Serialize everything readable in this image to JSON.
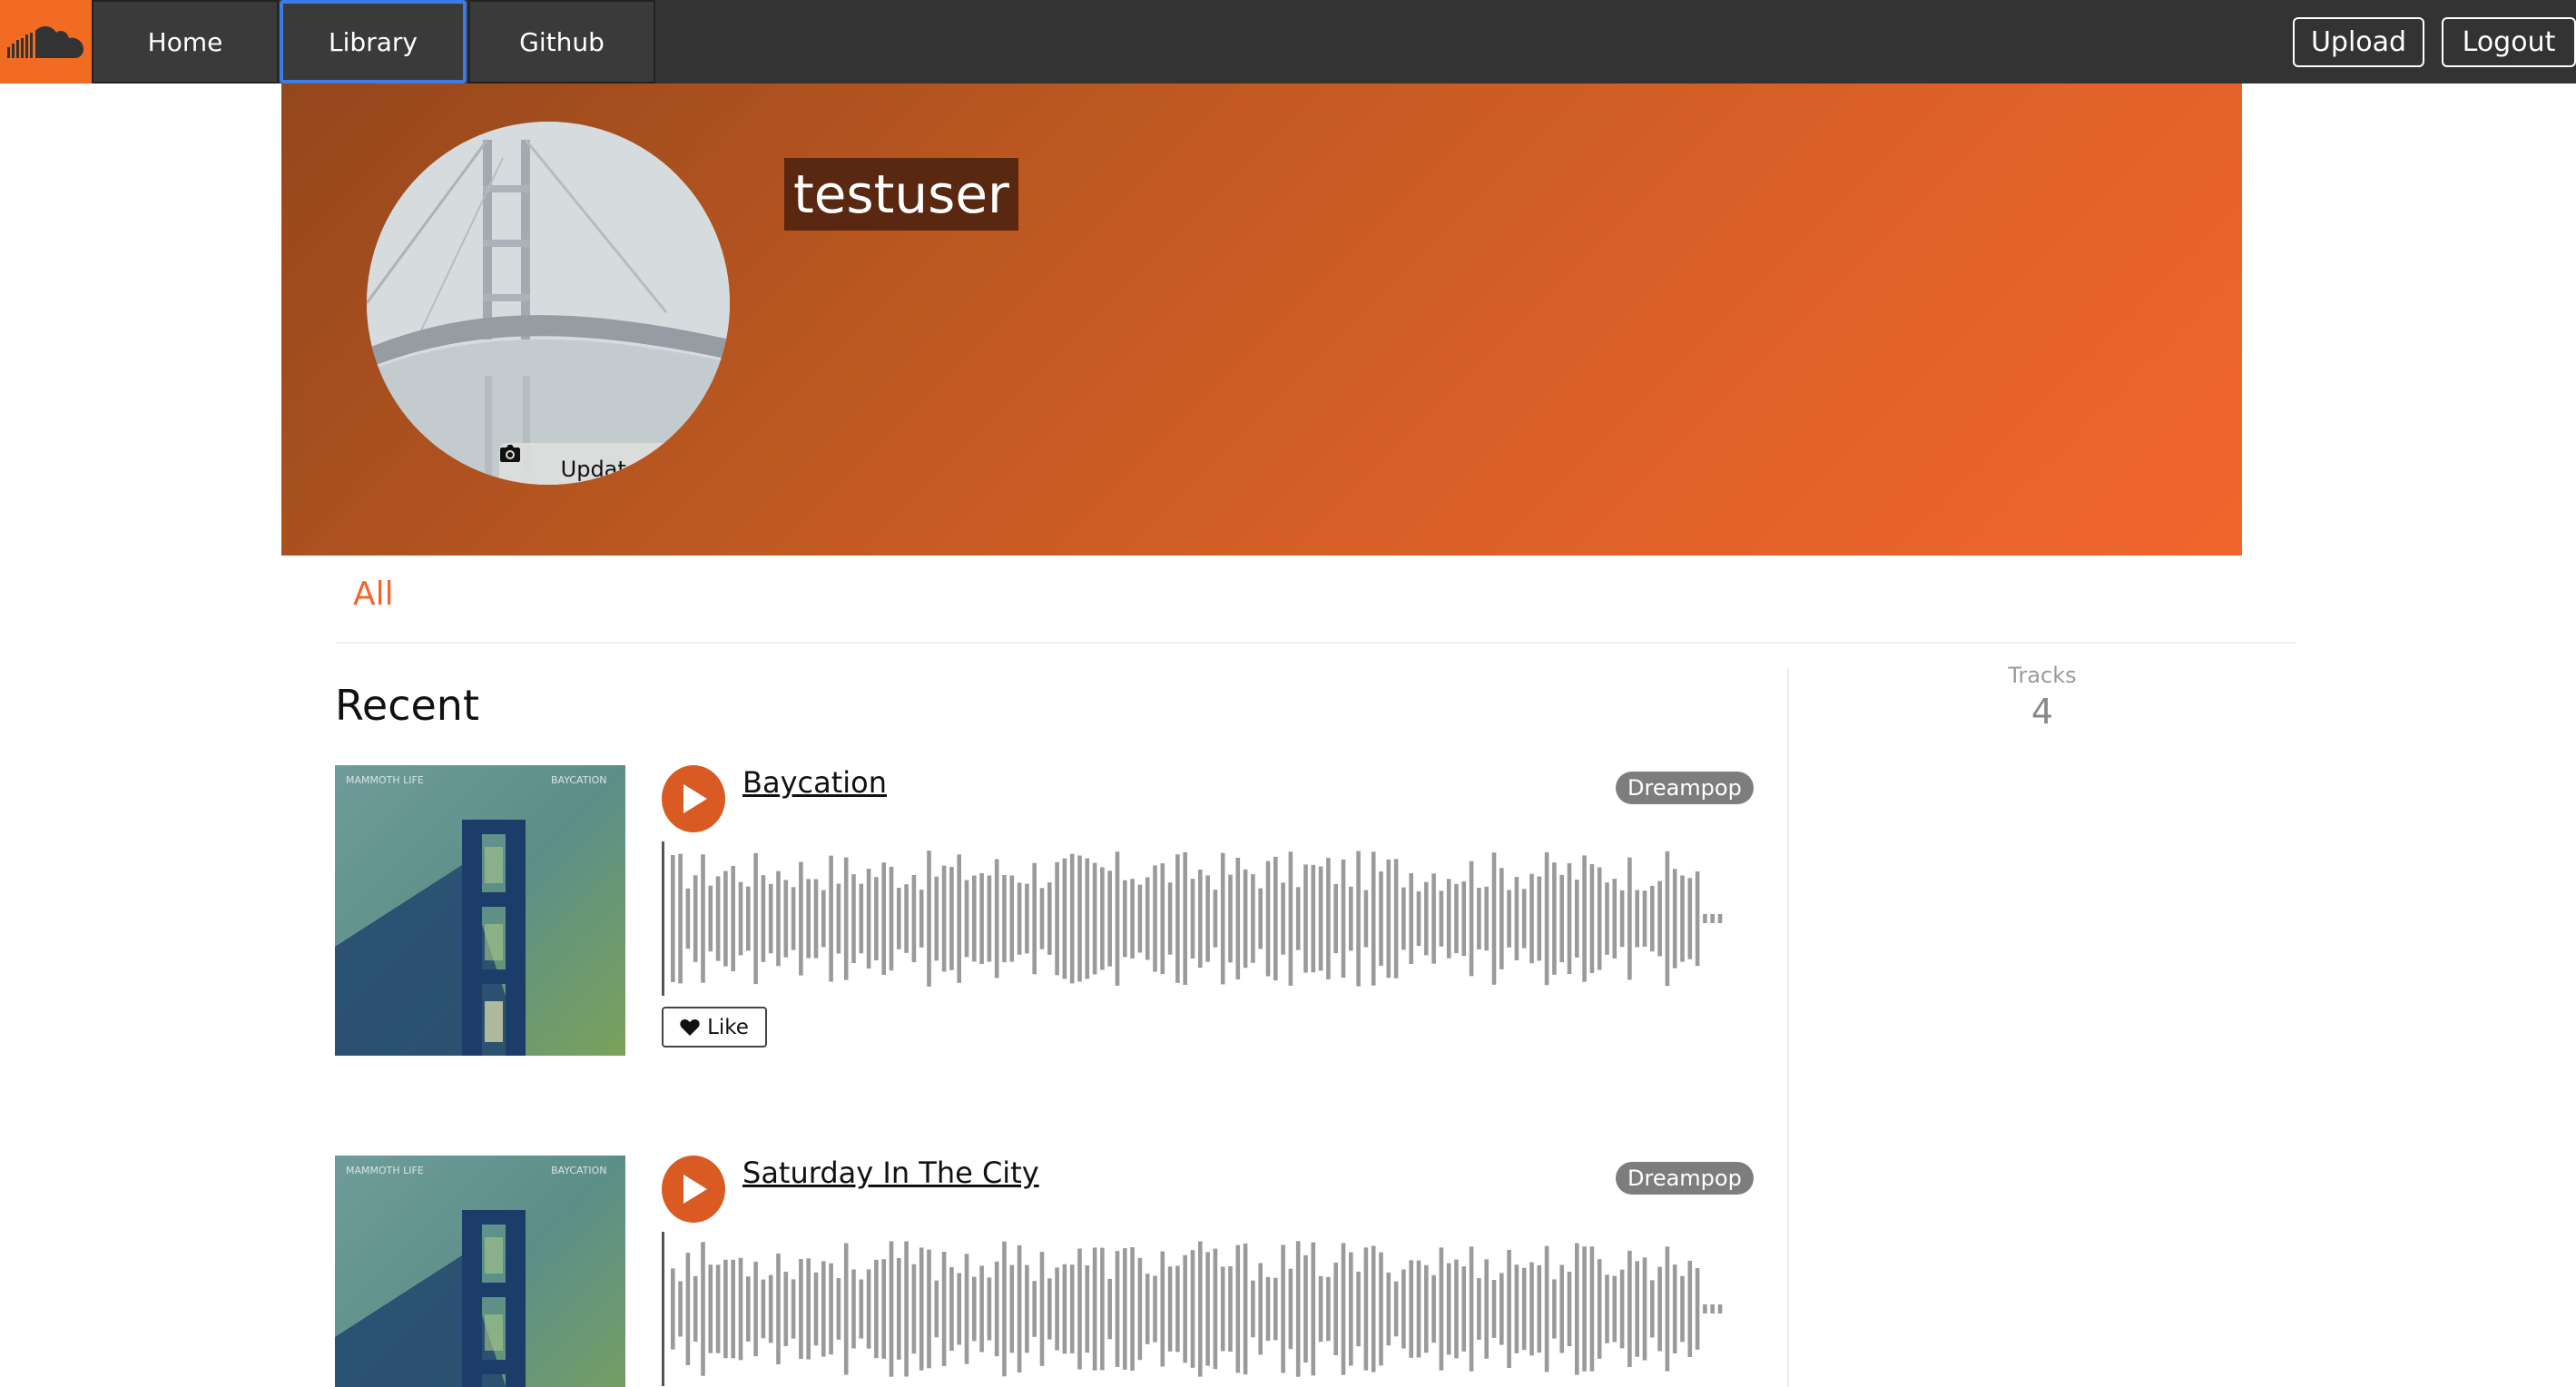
{
  "nav": {
    "logo_icon": "cloud-icon",
    "brand_color": "#f26b22",
    "tabs": [
      {
        "label": "Home"
      },
      {
        "label": "Library"
      },
      {
        "label": "Github"
      }
    ],
    "upload_label": "Upload",
    "logout_label": "Logout"
  },
  "profile": {
    "username": "testuser",
    "update_image_label": "Update Image",
    "update_image_icon": "camera-icon"
  },
  "tabs": {
    "all_label": "All"
  },
  "recent": {
    "title": "Recent",
    "tracks": [
      {
        "title": "Baycation",
        "genre": "Dreampop",
        "like_label": "Like",
        "like_icon": "heart-icon",
        "cover_text_left": "MAMMOTH LIFE",
        "cover_text_right": "BAYCATION"
      },
      {
        "title": "Saturday In The City",
        "genre": "Dreampop",
        "cover_text_left": "MAMMOTH LIFE",
        "cover_text_right": "BAYCATION"
      }
    ]
  },
  "stats": {
    "tracks_label": "Tracks",
    "tracks_value": "4"
  }
}
